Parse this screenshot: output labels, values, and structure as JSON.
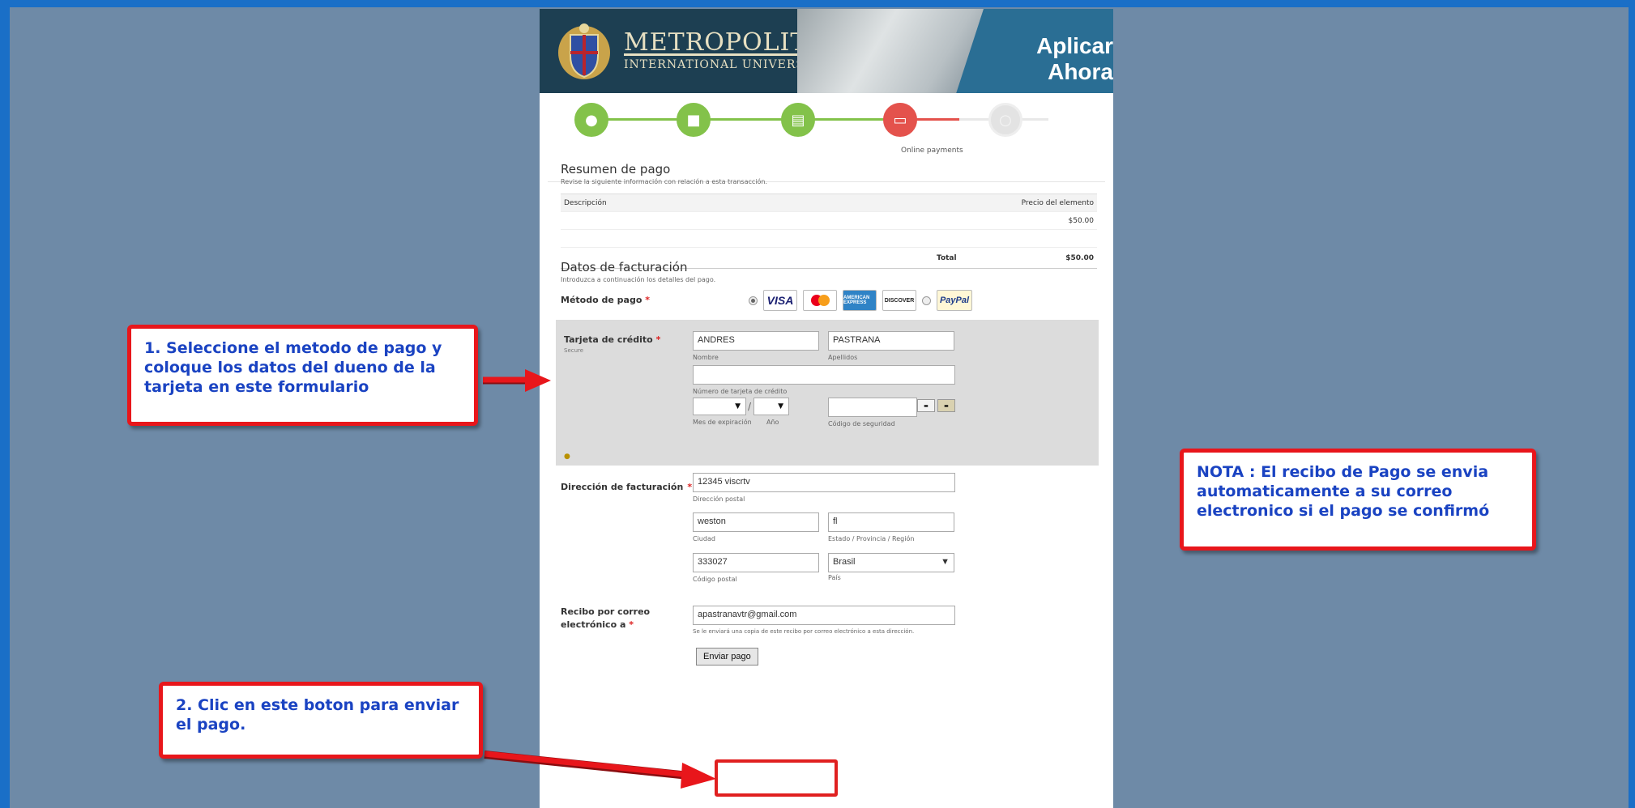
{
  "header": {
    "brand_line1": "METROPOLITAN",
    "brand_line2": "INTERNATIONAL UNIVERSITY",
    "apply": "Aplicar Ahora"
  },
  "steps": {
    "active_caption": "Online payments"
  },
  "summary": {
    "title": "Resumen de pago",
    "subtitle": "Revise la siguiente información con relación a esta transacción.",
    "col_description": "Descripción",
    "col_price": "Precio del elemento",
    "item_price": "$50.00",
    "total_label": "Total",
    "total_value": "$50.00"
  },
  "billing": {
    "title": "Datos de facturación",
    "subtitle": "Introduzca a continuación los detalles del pago.",
    "method_label": "Método de pago",
    "required_mark": "*",
    "cards": {
      "visa": "VISA",
      "mastercard": "MasterCard",
      "amex": "AMERICAN EXPRESS",
      "discover": "DISCOVER",
      "paypal": "PayPal"
    },
    "credit_card_label": "Tarjeta de crédito",
    "secure": "Secure",
    "first_name": "ANDRES",
    "first_name_hint": "Nombre",
    "last_name": "PASTRANA",
    "last_name_hint": "Apellidos",
    "card_number": "",
    "card_number_hint": "Número de tarjeta de crédito",
    "exp_hint": "Mes de expiración",
    "year_hint": "Año",
    "exp_sep": "/",
    "security_hint": "Código de seguridad",
    "address_label": "Dirección de facturación",
    "street": "12345 viscrtv",
    "street_hint": "Dirección postal",
    "city": "weston",
    "city_hint": "Ciudad",
    "state": "fl",
    "state_hint": "Estado / Provincia / Región",
    "zip": "333027",
    "zip_hint": "Código postal",
    "country": "Brasil",
    "country_hint": "País",
    "email_label_1": "Recibo por correo",
    "email_label_2": "electrónico a",
    "email": "apastranavtr@gmail.com",
    "email_hint": "Se le enviará una copia de este recibo por correo electrónico a esta dirección.",
    "submit": "Enviar pago"
  },
  "callouts": {
    "step1": "1. Seleccione el metodo de pago y coloque los datos del dueno de la tarjeta en este formulario",
    "step2": "2. Clic en este boton para enviar el pago.",
    "note": "NOTA : El recibo de Pago se envia automaticamente a su correo electronico si el pago se confirmó"
  },
  "colors": {
    "background": "#6e8aa7",
    "frame": "#1a6fc7",
    "callout_border": "#e8161b",
    "callout_text": "#1a43c2",
    "step_done": "#83c24a",
    "step_active": "#e4524c"
  }
}
